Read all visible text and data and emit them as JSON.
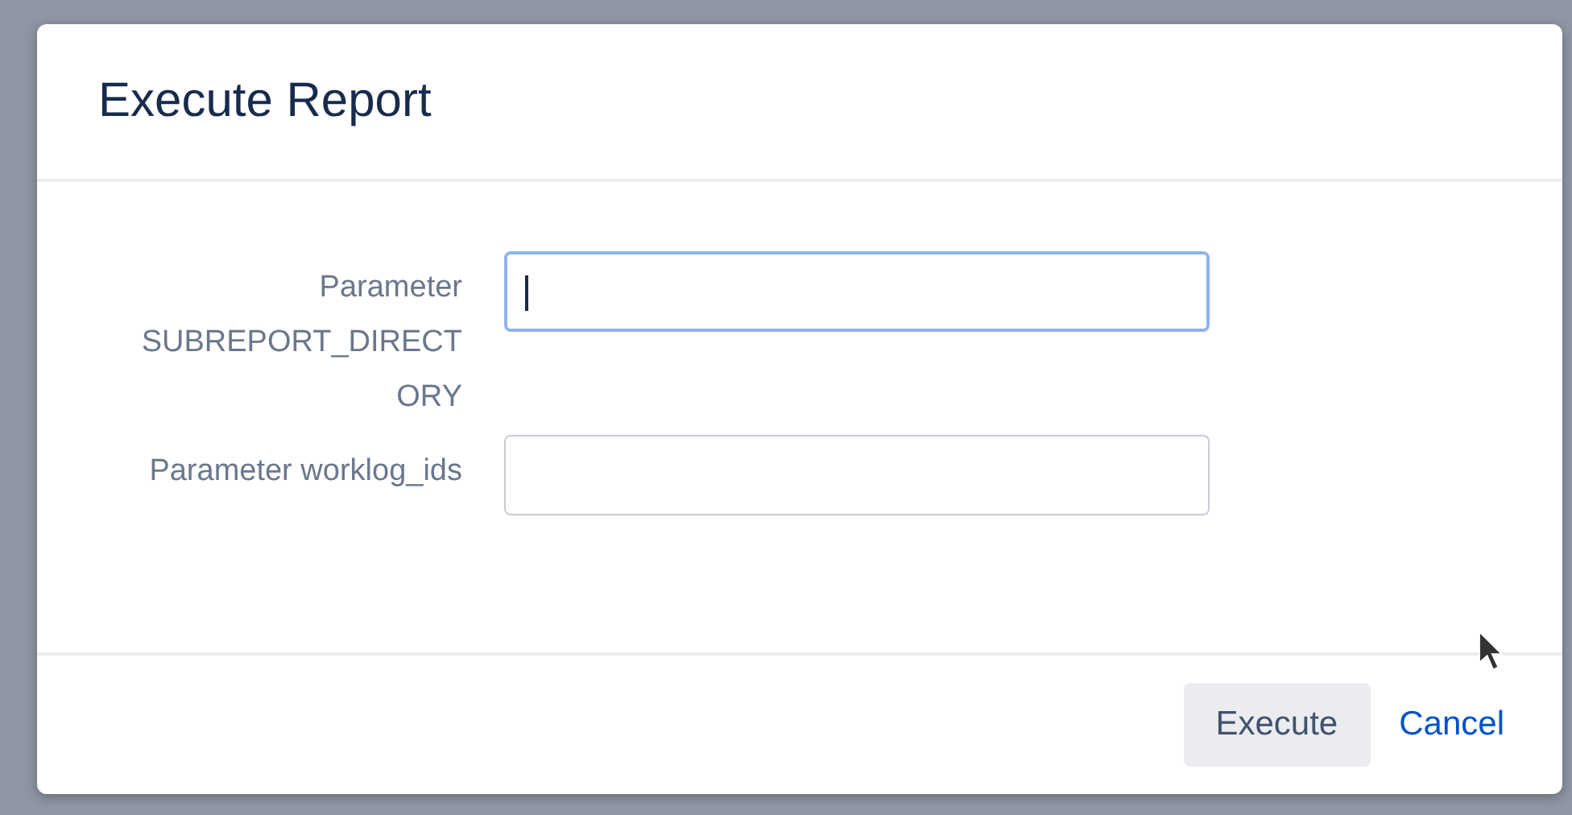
{
  "dialog": {
    "title": "Execute Report",
    "fields": [
      {
        "label": "Parameter SUBREPORT_DIRECTORY",
        "focused": true
      },
      {
        "label": "Parameter worklog_ids",
        "focused": false
      }
    ],
    "buttons": [
      {
        "label": "Execute",
        "kind": "primary"
      },
      {
        "label": "Cancel",
        "kind": "link"
      }
    ]
  }
}
